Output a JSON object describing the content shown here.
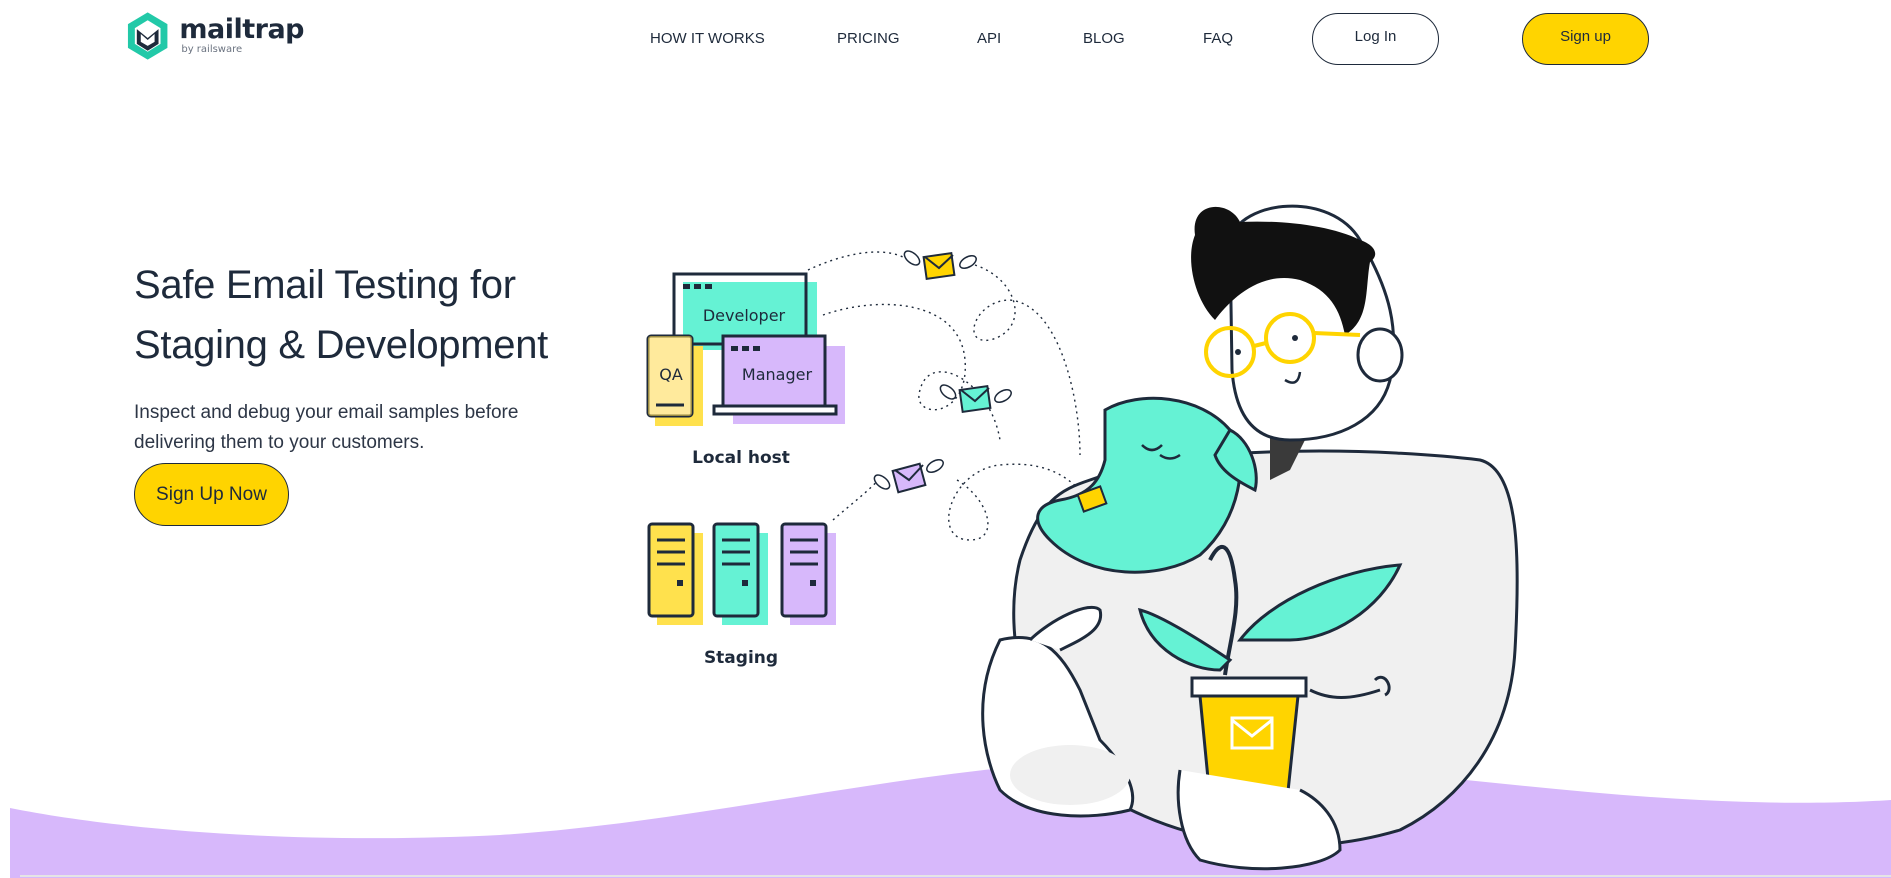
{
  "header": {
    "logo": {
      "name": "mailtrap",
      "byline": "by railsware"
    },
    "nav": [
      {
        "label": "HOW IT WORKS"
      },
      {
        "label": "PRICING"
      },
      {
        "label": "API"
      },
      {
        "label": "BLOG"
      },
      {
        "label": "FAQ"
      }
    ],
    "login_label": "Log In",
    "signup_label": "Sign up"
  },
  "hero": {
    "title_line1": "Safe Email Testing for",
    "title_line2": "Staging & Development",
    "subtitle_line1": "Inspect and debug your email samples before",
    "subtitle_line2": "delivering them to your customers.",
    "cta_label": "Sign Up Now"
  },
  "illustration": {
    "developer_label": "Developer",
    "manager_label": "Manager",
    "qa_label": "QA",
    "localhost_label": "Local host",
    "staging_label": "Staging"
  },
  "colors": {
    "brand_dark": "#1e2a3b",
    "accent_yellow": "#ffd400",
    "accent_teal": "#65f2d4",
    "accent_purple": "#d7b8fb",
    "brand_teal": "#22c9a8"
  }
}
